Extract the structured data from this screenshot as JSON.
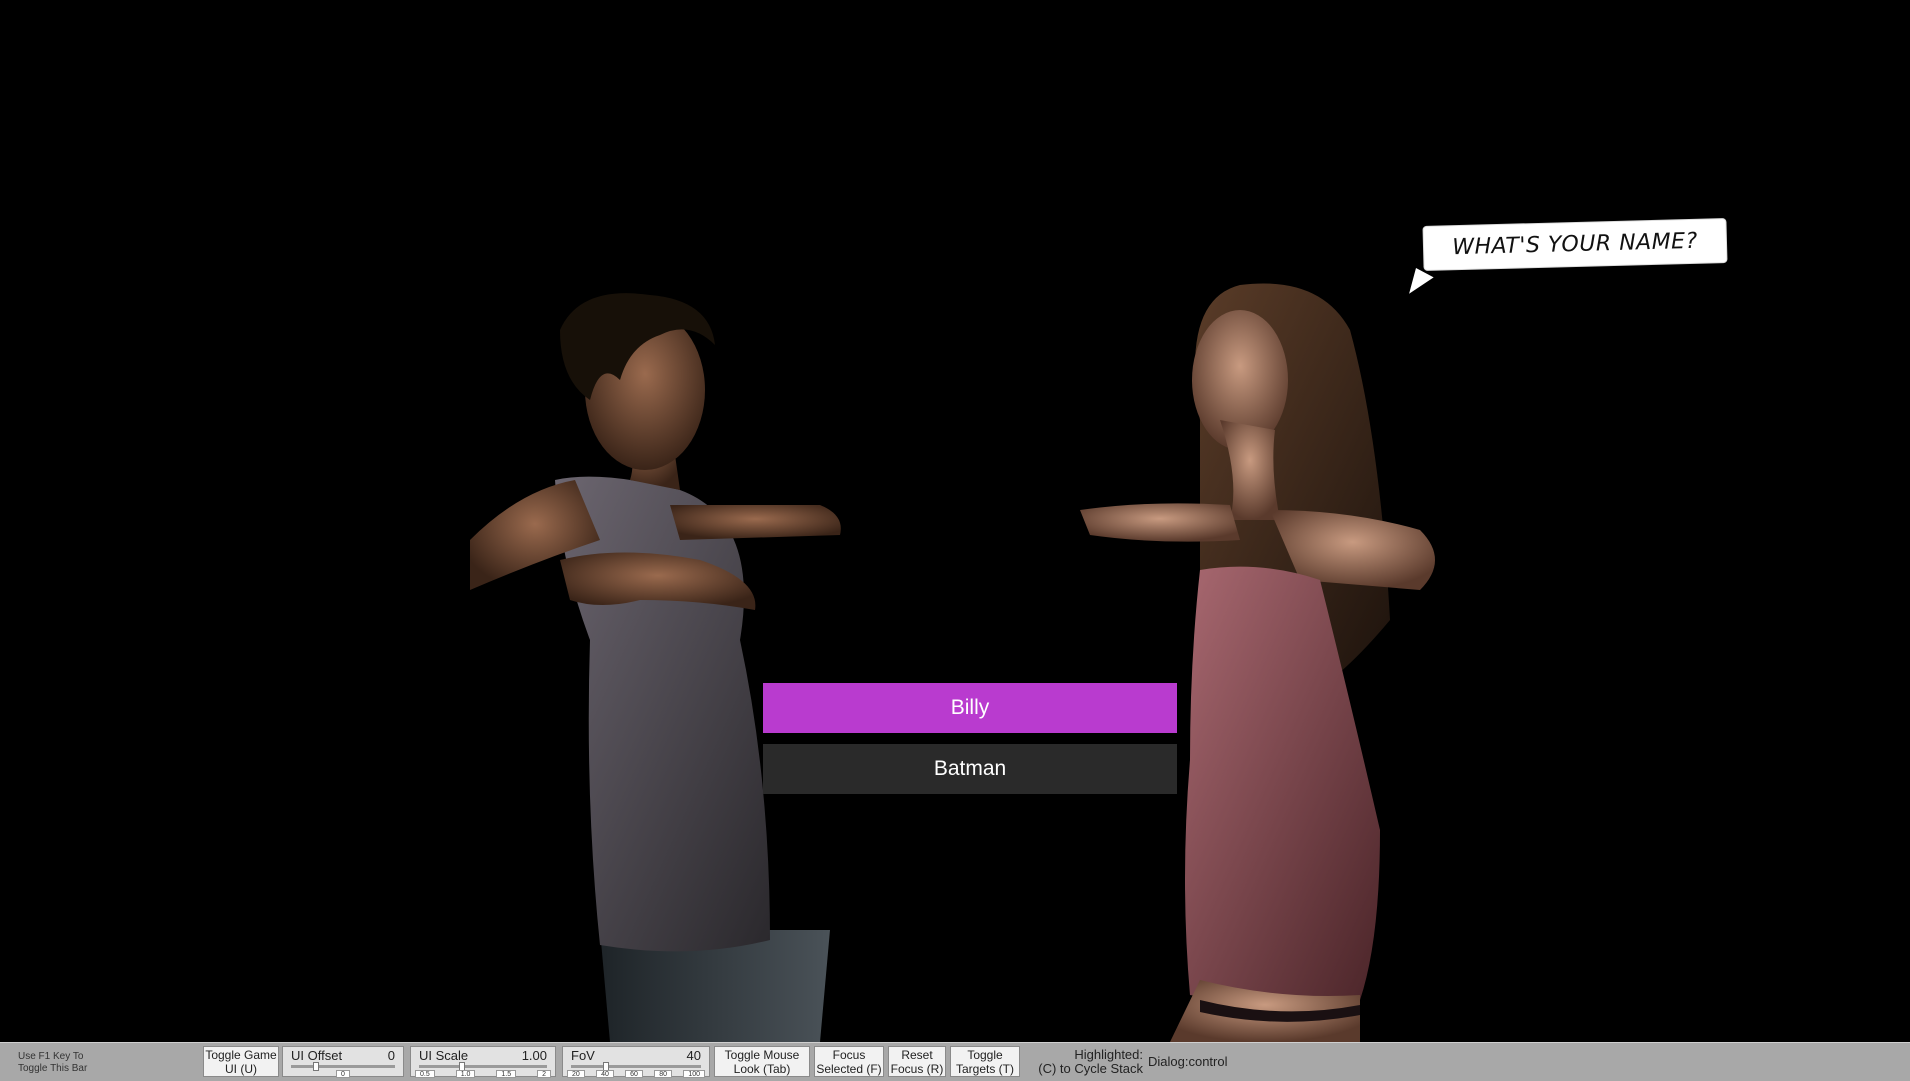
{
  "dialog": {
    "speech": "WHAT'S YOUR NAME?",
    "choices": [
      {
        "label": "Billy",
        "selected": true
      },
      {
        "label": "Batman",
        "selected": false
      }
    ]
  },
  "devbar": {
    "hint_line1": "Use F1 Key To",
    "hint_line2": "Toggle This Bar",
    "toggle_game_ui": [
      "Toggle Game",
      "UI (U)"
    ],
    "ui_offset": {
      "label": "UI Offset",
      "value": "0",
      "ticks": [
        "0"
      ]
    },
    "ui_scale": {
      "label": "UI Scale",
      "value": "1.00",
      "ticks": [
        "0.5",
        "1.0",
        "1.5",
        "2"
      ]
    },
    "fov": {
      "label": "FoV",
      "value": "40",
      "ticks": [
        "20",
        "40",
        "60",
        "80",
        "100"
      ]
    },
    "toggle_mouse_look": [
      "Toggle Mouse",
      "Look (Tab)"
    ],
    "focus_selected": [
      "Focus",
      "Selected (F)"
    ],
    "reset_focus": [
      "Reset",
      "Focus (R)"
    ],
    "toggle_targets": [
      "Toggle",
      "Targets (T)"
    ],
    "highlighted_label": [
      "Highlighted:",
      "(C) to Cycle Stack"
    ],
    "highlighted_value": "Dialog:control"
  },
  "colors": {
    "selected_choice": "#b93bcf",
    "normal_choice": "#2a2a2a",
    "bar_bg": "#a8a8a8"
  }
}
